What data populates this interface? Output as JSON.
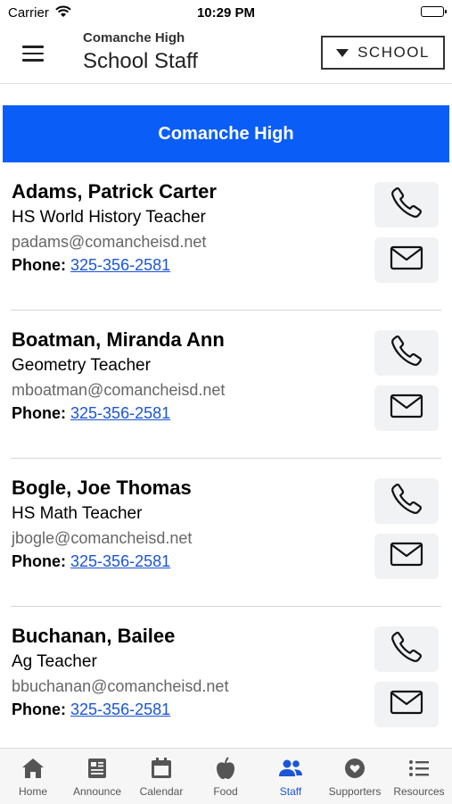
{
  "status_bar": {
    "carrier": "Carrier",
    "time": "10:29 PM"
  },
  "header": {
    "subtitle": "Comanche High",
    "title": "School Staff",
    "school_button": "SCHOOL"
  },
  "banner": {
    "school_name": "Comanche High"
  },
  "phone_label": "Phone:",
  "staff": [
    {
      "name": "Adams, Patrick Carter",
      "role": "HS World History Teacher",
      "email": "padams@comancheisd.net",
      "phone": "325-356-2581"
    },
    {
      "name": "Boatman, Miranda Ann",
      "role": "Geometry Teacher",
      "email": "mboatman@comancheisd.net",
      "phone": "325-356-2581"
    },
    {
      "name": "Bogle, Joe Thomas",
      "role": "HS Math Teacher",
      "email": "jbogle@comancheisd.net",
      "phone": "325-356-2581"
    },
    {
      "name": "Buchanan, Bailee",
      "role": "Ag Teacher",
      "email": "bbuchanan@comancheisd.net",
      "phone": "325-356-2581"
    }
  ],
  "tabs": [
    {
      "label": "Home",
      "icon": "home-icon"
    },
    {
      "label": "Announce",
      "icon": "newspaper-icon"
    },
    {
      "label": "Calendar",
      "icon": "calendar-icon"
    },
    {
      "label": "Food",
      "icon": "apple-icon"
    },
    {
      "label": "Staff",
      "icon": "people-icon",
      "active": true
    },
    {
      "label": "Supporters",
      "icon": "heart-icon"
    },
    {
      "label": "Resources",
      "icon": "list-icon"
    }
  ],
  "colors": {
    "accent": "#0a5ef7",
    "link": "#1a55d6",
    "active_tab": "#1a55d6",
    "inactive_tab": "#555555"
  }
}
